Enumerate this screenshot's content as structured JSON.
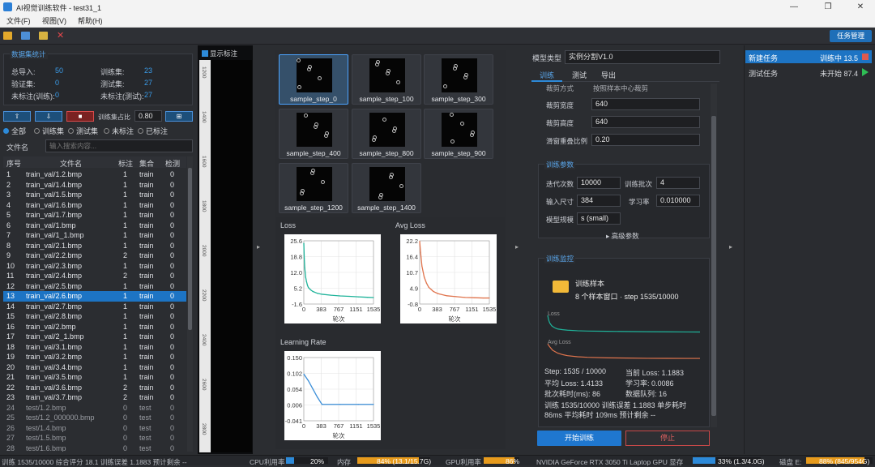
{
  "window": {
    "title": "AI视觉训练软件 - test31_1"
  },
  "menu": [
    "文件(F)",
    "视图(V)",
    "帮助(H)"
  ],
  "toolbar": {
    "task_mgmt": "任务管理"
  },
  "stats": {
    "title": "数据集统计",
    "total_label": "总导入:",
    "total": "50",
    "train_label": "训练集:",
    "train": "23",
    "val_label": "验证集:",
    "val": "0",
    "test_label": "测试集:",
    "test": "27",
    "unl_train_label": "未标注(训练):",
    "unl_train": "0",
    "unl_test_label": "未标注(测试):",
    "unl_test": "27"
  },
  "split": {
    "ratio_label": "训练集占比",
    "ratio": "0.80"
  },
  "filters": [
    "全部",
    "训练集",
    "测试集",
    "未标注",
    "已标注"
  ],
  "filename": {
    "label": "文件名",
    "placeholder": "输入搜索内容..."
  },
  "table": {
    "headers": [
      "序号",
      "文件名",
      "标注",
      "集合",
      "检测"
    ],
    "rows": [
      [
        "1",
        "train_val/1.2.bmp",
        "1",
        "train",
        "0"
      ],
      [
        "2",
        "train_val/1.4.bmp",
        "1",
        "train",
        "0"
      ],
      [
        "3",
        "train_val/1.5.bmp",
        "1",
        "train",
        "0"
      ],
      [
        "4",
        "train_val/1.6.bmp",
        "1",
        "train",
        "0"
      ],
      [
        "5",
        "train_val/1.7.bmp",
        "1",
        "train",
        "0"
      ],
      [
        "6",
        "train_val/1.bmp",
        "1",
        "train",
        "0"
      ],
      [
        "7",
        "train_val/1_1.bmp",
        "1",
        "train",
        "0"
      ],
      [
        "8",
        "train_val/2.1.bmp",
        "1",
        "train",
        "0"
      ],
      [
        "9",
        "train_val/2.2.bmp",
        "2",
        "train",
        "0"
      ],
      [
        "10",
        "train_val/2.3.bmp",
        "1",
        "train",
        "0"
      ],
      [
        "11",
        "train_val/2.4.bmp",
        "2",
        "train",
        "0"
      ],
      [
        "12",
        "train_val/2.5.bmp",
        "1",
        "train",
        "0"
      ],
      [
        "13",
        "train_val/2.6.bmp",
        "1",
        "train",
        "0"
      ],
      [
        "14",
        "train_val/2.7.bmp",
        "1",
        "train",
        "0"
      ],
      [
        "15",
        "train_val/2.8.bmp",
        "1",
        "train",
        "0"
      ],
      [
        "16",
        "train_val/2.bmp",
        "1",
        "train",
        "0"
      ],
      [
        "17",
        "train_val/2_1.bmp",
        "1",
        "train",
        "0"
      ],
      [
        "18",
        "train_val/3.1.bmp",
        "1",
        "train",
        "0"
      ],
      [
        "19",
        "train_val/3.2.bmp",
        "1",
        "train",
        "0"
      ],
      [
        "20",
        "train_val/3.4.bmp",
        "1",
        "train",
        "0"
      ],
      [
        "21",
        "train_val/3.5.bmp",
        "1",
        "train",
        "0"
      ],
      [
        "22",
        "train_val/3.6.bmp",
        "2",
        "train",
        "0"
      ],
      [
        "23",
        "train_val/3.7.bmp",
        "2",
        "train",
        "0"
      ],
      [
        "24",
        "test/1.2.bmp",
        "0",
        "test",
        "0"
      ],
      [
        "25",
        "test/1.2_000000.bmp",
        "0",
        "test",
        "0"
      ],
      [
        "26",
        "test/1.4.bmp",
        "0",
        "test",
        "0"
      ],
      [
        "27",
        "test/1.5.bmp",
        "0",
        "test",
        "0"
      ],
      [
        "28",
        "test/1.6.bmp",
        "0",
        "test",
        "0"
      ]
    ]
  },
  "viewer": {
    "show_label": "显示标注",
    "ruler_ticks": [
      "1200",
      "1400",
      "1600",
      "1800",
      "2000",
      "2200",
      "2400",
      "2600",
      "2800"
    ]
  },
  "samples": [
    "sample_step_0",
    "sample_step_100",
    "sample_step_300",
    "sample_step_400",
    "sample_step_800",
    "sample_step_900",
    "sample_step_1200",
    "sample_step_1400"
  ],
  "chart_data": [
    {
      "type": "line",
      "title": "Loss",
      "xlabel": "轮次",
      "ylabel": "",
      "xticks": [
        "0",
        "383",
        "767",
        "1151",
        "1535"
      ],
      "yticks": [
        "25.6",
        "18.8",
        "12.0",
        "5.2",
        "-1.6"
      ],
      "xlim": [
        0,
        1535
      ],
      "ylim": [
        -1.6,
        25.6
      ],
      "series": [
        {
          "color": "#1fb39a",
          "x": [
            0,
            10,
            20,
            40,
            60,
            80,
            100,
            150,
            200,
            300,
            400,
            600,
            800,
            1000,
            1200,
            1400,
            1535
          ],
          "y": [
            24.5,
            18,
            14,
            10,
            8,
            6.5,
            5.5,
            4.5,
            3.8,
            3.0,
            2.6,
            2.2,
            1.9,
            1.7,
            1.5,
            1.3,
            1.2
          ]
        }
      ]
    },
    {
      "type": "line",
      "title": "Avg Loss",
      "xlabel": "轮次",
      "ylabel": "",
      "xticks": [
        "0",
        "383",
        "767",
        "1151",
        "1535"
      ],
      "yticks": [
        "22.2",
        "16.4",
        "10.7",
        "4.9",
        "-0.8"
      ],
      "xlim": [
        0,
        1535
      ],
      "ylim": [
        -0.8,
        22.2
      ],
      "series": [
        {
          "color": "#e0744d",
          "x": [
            0,
            20,
            50,
            100,
            150,
            200,
            300,
            400,
            600,
            800,
            1000,
            1200,
            1400,
            1535
          ],
          "y": [
            22,
            18,
            13,
            9,
            6.8,
            5.3,
            3.8,
            3.0,
            2.2,
            1.9,
            1.6,
            1.5,
            1.4,
            1.4
          ]
        }
      ]
    },
    {
      "type": "line",
      "title": "Learning Rate",
      "xlabel": "轮次",
      "ylabel": "",
      "xticks": [
        "0",
        "383",
        "767",
        "1151",
        "1535"
      ],
      "yticks": [
        "0.150",
        "0.102",
        "0.054",
        "0.006",
        "-0.041"
      ],
      "xlim": [
        0,
        1535
      ],
      "ylim": [
        -0.041,
        0.15
      ],
      "series": [
        {
          "color": "#3b8ed8",
          "x": [
            0,
            100,
            200,
            300,
            400,
            800,
            1200,
            1535
          ],
          "y": [
            0.1,
            0.08,
            0.055,
            0.03,
            0.0086,
            0.0086,
            0.0086,
            0.0086
          ]
        }
      ]
    }
  ],
  "right": {
    "model_label": "模型类型",
    "model_value": "实例分割V1.0",
    "tabs": [
      "训练",
      "测试",
      "导出"
    ],
    "cut_label": "裁剪方式",
    "cut_value": "按照样本中心裁剪",
    "crop_w_label": "裁剪宽度",
    "crop_w": "640",
    "crop_h_label": "裁剪高度",
    "crop_h": "640",
    "overlap_label": "滑窗重叠比例",
    "overlap": "0.20",
    "params_title": "训练参数",
    "iter_label": "迭代次数",
    "iter": "10000",
    "batch_label": "训练批次",
    "batch": "4",
    "input_label": "输入尺寸",
    "input": "384",
    "lr_label": "学习率",
    "lr": "0.010000",
    "scale_label": "模型规模",
    "scale": "s (small)",
    "advanced": "▸ 高级参数",
    "monitor_title": "训练监控",
    "sample_title": "训练样本",
    "sample_sub": "8 个样本窗口 · step 1535/10000",
    "mini_loss": "Loss",
    "mini_avg": "Avg Loss",
    "step": "Step: 1535 / 10000",
    "cur_loss": "当前 Loss: 1.1883",
    "avg_loss": "平均 Loss: 1.4133",
    "lr_now": "学习率: 0.0086",
    "batch_time": "批次耗时(ms): 86",
    "queue": "数据队列: 16",
    "summary1": "训练 1535/10000  训练误差 1.1883  单步耗时",
    "summary2": "86ms  平均耗时 109ms  预计剩余 --",
    "start": "开始训练",
    "stop": "停止"
  },
  "tasks": [
    {
      "name": "新建任务",
      "status": "训练中 13.5",
      "color": "#e05a4f",
      "icon": "stop-icon"
    },
    {
      "name": "测试任务",
      "status": "未开始 87.4",
      "color": "#2fbf55",
      "icon": "play-icon"
    }
  ],
  "status": {
    "left": "训练 1535/10000  综合评分 18.1  训练误差 1.1883  预计剩余 --",
    "cpu_label": "CPU利用率",
    "cpu": "20%",
    "cpu_frac": 0.2,
    "mem_label": "内存",
    "mem": "84% (13.1/15.7G)",
    "mem_frac": 0.84,
    "gpu_label": "GPU利用率",
    "gpu": "86%",
    "gpu_frac": 0.86,
    "gpuname": "NVIDIA GeForce RTX 3050 Ti Laptop GPU 显存",
    "vram": "33% (1.3/4.0G)",
    "vram_frac": 0.33,
    "disk_label": "磁盘 E:",
    "disk": "88% (845/954G)",
    "disk_frac": 0.88,
    "colors": {
      "blue": "#2d8ad9",
      "orange": "#e79b1d"
    }
  }
}
